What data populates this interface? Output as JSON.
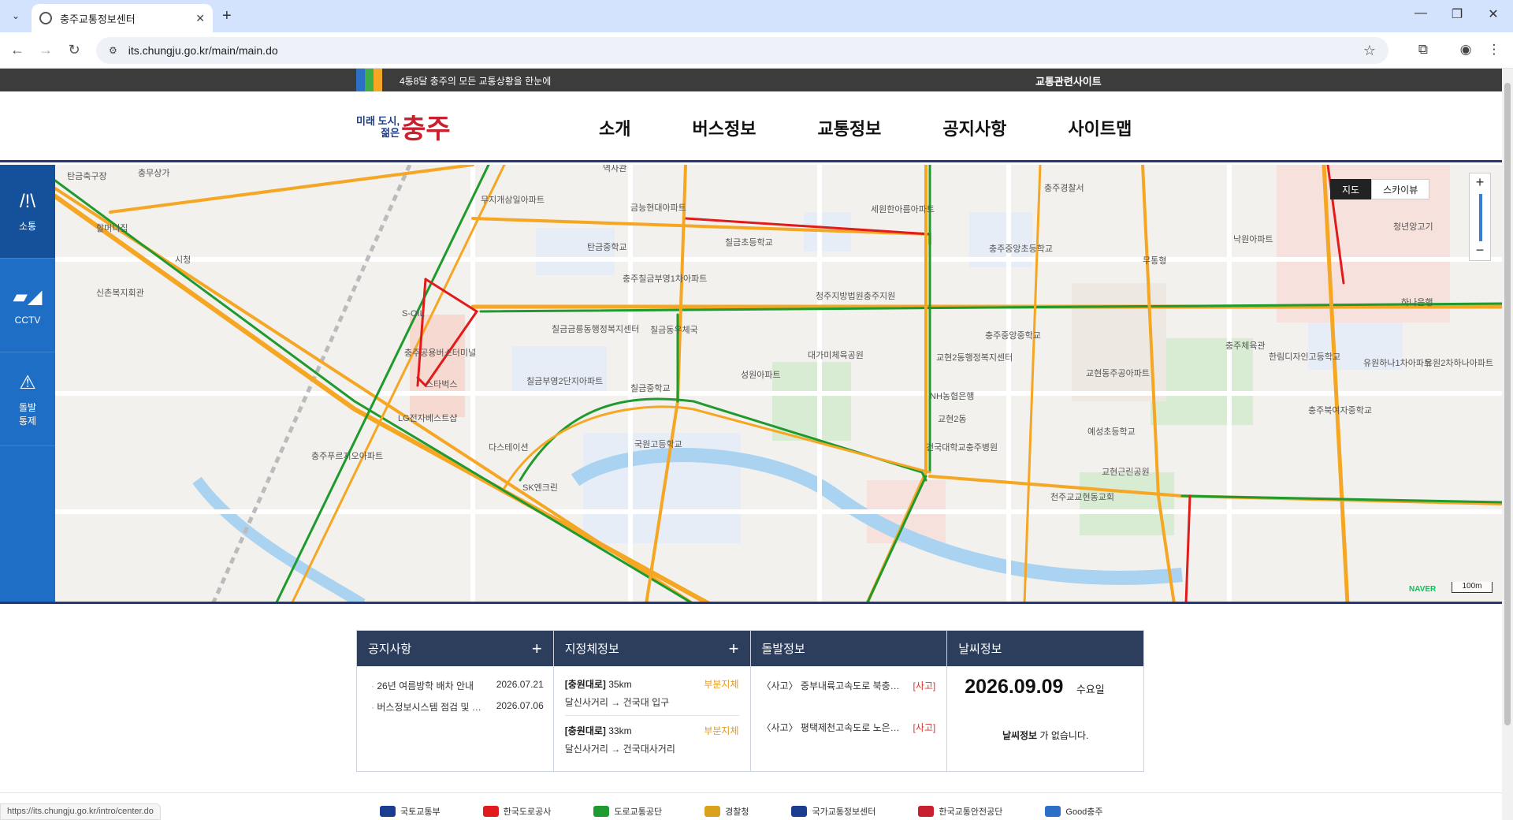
{
  "browser": {
    "tab_title": "충주교통정보센터",
    "url": "its.chungju.go.kr/main/main.do",
    "status_url": "https://its.chungju.go.kr/intro/center.do"
  },
  "topstrip": {
    "slogan": "4통8달 충주의 모든 교통상황을 한눈에",
    "related_sites": "교통관련사이트",
    "colors": [
      "#2c6fc4",
      "#3fae49",
      "#f5a623"
    ]
  },
  "header": {
    "logo_small_1": "미래 도시,",
    "logo_small_2": "젊은",
    "logo_big": "충주",
    "nav": [
      "소개",
      "버스정보",
      "교통정보",
      "공지사항",
      "사이트맵"
    ]
  },
  "sidenav": [
    {
      "label": "소통",
      "icon": "road-icon"
    },
    {
      "label": "CCTV",
      "icon": "cctv-icon"
    },
    {
      "label": "돌발\n통제",
      "icon": "warning-icon"
    }
  ],
  "map": {
    "type_map": "지도",
    "type_sky": "스카이뷰",
    "scale": "100m",
    "brand": "NAVER",
    "labels": [
      "탄금축구장",
      "충무상가",
      "할머니집",
      "시청",
      "신촌복지회관",
      "무지개삼일아파트",
      "금능현대아파트",
      "역사관",
      "탄금중학교",
      "칠금초등학교",
      "세원한아름아파트",
      "충주경찰서",
      "충주중앙초등학교",
      "S-OIL",
      "충주공용버스터미널",
      "충주칠금부영1차아파트",
      "칠금금릉동행정복지센터",
      "칠금부영2단지아파트",
      "스타벅스",
      "LG전자베스트샵",
      "칠금중학교",
      "대가미체육공원",
      "성원아파트",
      "국원고등학교",
      "교현2동행정복지센터",
      "NH농협은행",
      "교현2동",
      "건국대학교충주병원",
      "예성초등학교",
      "교현근린공원",
      "천주교교현동교회",
      "충주체육관",
      "유원하나1차아파트",
      "유원2차하나아파트",
      "충주북여자중학교",
      "한림디자인고등학교",
      "하나은행",
      "청년앙고기",
      "낙원아파트",
      "충주중앙중학교",
      "교현동주공아파트",
      "무통형",
      "SK엔크린",
      "다스테이션",
      "충주푸르지오아파트",
      "칠금동우체국",
      "청주지방법원충주지원"
    ]
  },
  "boxes": {
    "notice": {
      "title": "공지사항",
      "items": [
        {
          "title": "26년 여름방학 배차 안내",
          "date": "2026.07.21"
        },
        {
          "title": "버스정보시스템 점검 및 …",
          "date": "2026.07.06"
        }
      ]
    },
    "congestion": {
      "title": "지정체정보",
      "items": [
        {
          "road": "[충원대로]",
          "dist": "35km",
          "status": "부분지체",
          "section": "달신사거리 → 건국대 입구"
        },
        {
          "road": "[충원대로]",
          "dist": "33km",
          "status": "부분지체",
          "section": "달신사거리 → 건국대사거리"
        }
      ]
    },
    "incident": {
      "title": "돌발정보",
      "items": [
        {
          "text": "〈사고〉 중부내륙고속도로 북충주…",
          "tag": "[사고]"
        },
        {
          "text": "〈사고〉 평택제천고속도로 노은4…",
          "tag": "[사고]"
        }
      ]
    },
    "weather": {
      "title": "날씨정보",
      "date": "2026.09.09",
      "dow": "수요일",
      "none_bold": "날씨정보",
      "none_rest": " 가 없습니다."
    }
  },
  "partners": [
    "국토교통부",
    "한국도로공사",
    "도로교통공단",
    "경찰청",
    "국가교통정보센터",
    "한국교통안전공단",
    "Good충주"
  ]
}
